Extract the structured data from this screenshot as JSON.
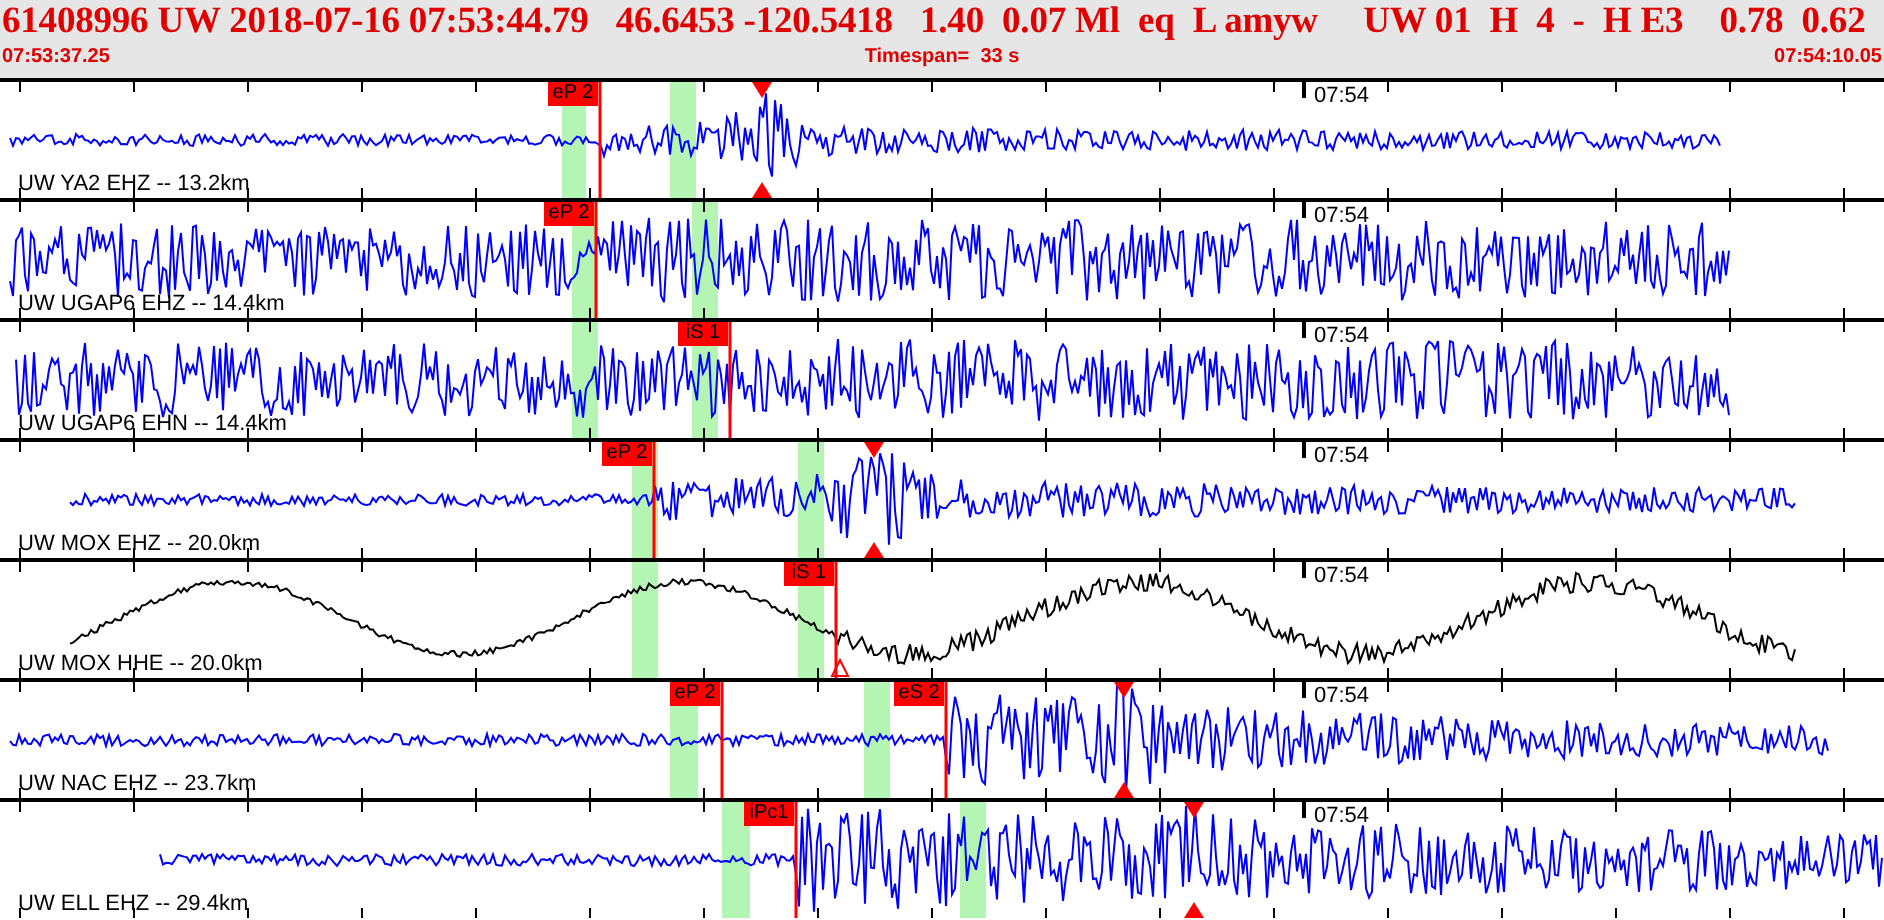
{
  "header": {
    "event_line": "61408996 UW 2018-07-16 07:53:44.79   46.6453 -120.5418   1.40  0.07 Ml  eq  L amyw     UW 01  H  4  -  H E3    0.78  0.62",
    "start_time": "07:53:37.25",
    "timespan": "Timespan=  33 s",
    "end_time": "07:54:10.05"
  },
  "traces": [
    {
      "station": "UW YA2 EHZ -- 13.2km",
      "time_label": "07:54",
      "color": "#0000ff",
      "picks": [
        {
          "label": "eP 2"
        }
      ]
    },
    {
      "station": "UW UGAP6 EHZ -- 14.4km",
      "time_label": "07:54",
      "color": "#0000ff",
      "picks": [
        {
          "label": "eP 2"
        }
      ]
    },
    {
      "station": "UW UGAP6 EHN -- 14.4km",
      "time_label": "07:54",
      "color": "#0000ff",
      "picks": [
        {
          "label": "iS 1"
        }
      ]
    },
    {
      "station": "UW MOX EHZ -- 20.0km",
      "time_label": "07:54",
      "color": "#0000ff",
      "picks": [
        {
          "label": "eP 2"
        }
      ]
    },
    {
      "station": "UW MOX HHE -- 20.0km",
      "time_label": "07:54",
      "color": "#000000",
      "picks": [
        {
          "label": "iS 1"
        }
      ]
    },
    {
      "station": "UW NAC EHZ -- 23.7km",
      "time_label": "07:54",
      "color": "#0000ff",
      "picks": [
        {
          "label": "eP 2"
        },
        {
          "label": "eS 2"
        }
      ]
    },
    {
      "station": "UW ELL EHZ -- 29.4km",
      "time_label": "07:54",
      "color": "#0000ff",
      "picks": [
        {
          "label": "iPc1"
        }
      ]
    }
  ]
}
